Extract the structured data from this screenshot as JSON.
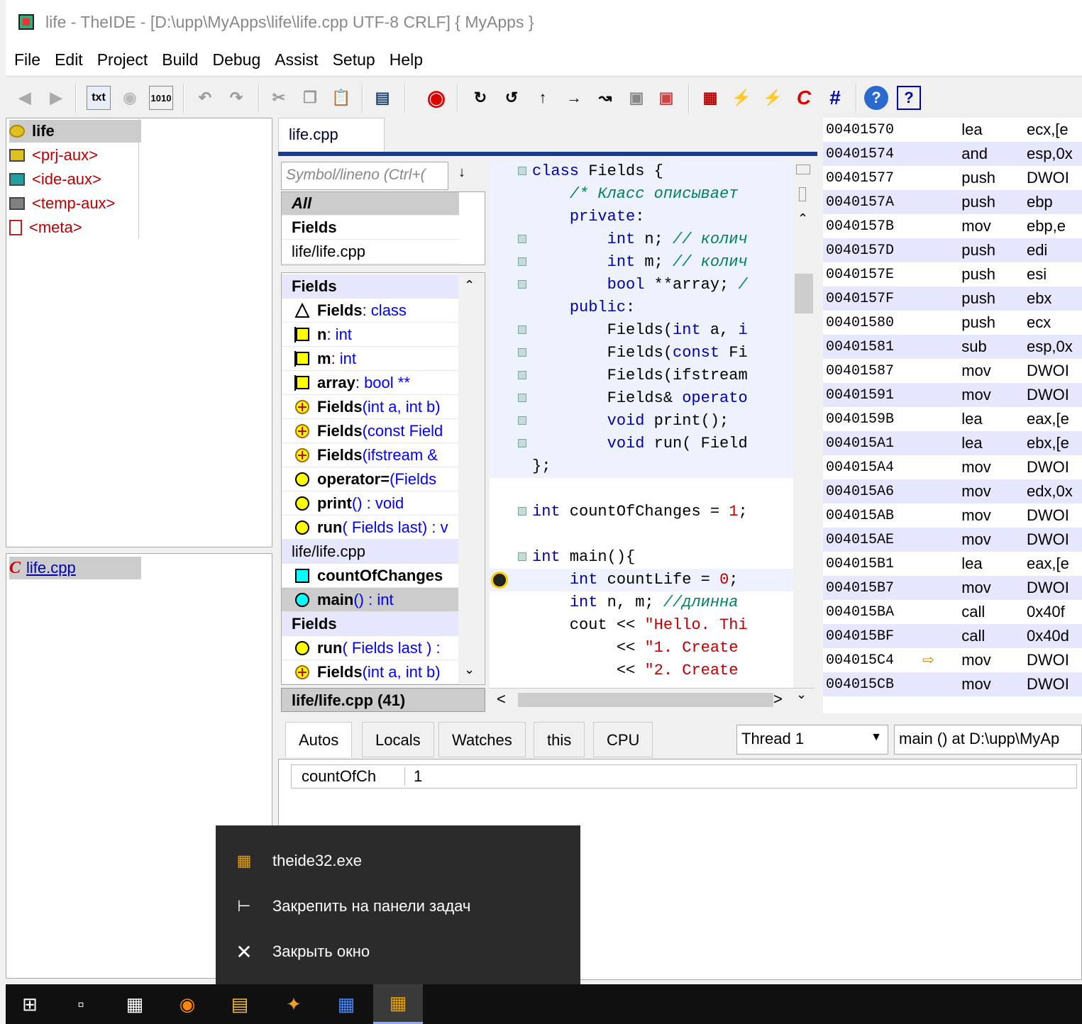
{
  "window": {
    "title": "life - TheIDE - [D:\\upp\\MyApps\\life\\life.cpp UTF-8 CRLF] { MyApps }"
  },
  "menu": [
    "File",
    "Edit",
    "Project",
    "Build",
    "Debug",
    "Assist",
    "Setup",
    "Help"
  ],
  "toolbar": {
    "txt_label": "txt",
    "hex_label": "1010",
    "help_label": "?"
  },
  "packages": {
    "items": [
      {
        "label": "life",
        "color": "#e0c020"
      },
      {
        "label": "<prj-aux>",
        "color": "#e0c020"
      },
      {
        "label": "<ide-aux>",
        "color": "#20a0a0"
      },
      {
        "label": "<temp-aux>",
        "color": "#808080"
      },
      {
        "label": "<meta>",
        "color": "#c02020"
      }
    ]
  },
  "files": {
    "items": [
      {
        "label": "life.cpp"
      }
    ]
  },
  "editor": {
    "tab": "life.cpp"
  },
  "navigator": {
    "search_placeholder": "Symbol/lineno (Ctrl+(",
    "scopes": [
      "All",
      "Fields",
      "life/life.cpp"
    ],
    "members": [
      {
        "type": "header",
        "label": "Fields"
      },
      {
        "icon": "triangle",
        "name": "Fields",
        "sig": " : class"
      },
      {
        "icon": "square",
        "name": "n",
        "sig": " : int"
      },
      {
        "icon": "square",
        "name": "m",
        "sig": " : int"
      },
      {
        "icon": "square",
        "name": "array",
        "sig": " : bool **"
      },
      {
        "icon": "ctor",
        "name": "Fields",
        "sig": "(int a, int b)"
      },
      {
        "icon": "ctor",
        "name": "Fields",
        "sig": "(const Field"
      },
      {
        "icon": "ctor",
        "name": "Fields",
        "sig": "(ifstream &"
      },
      {
        "icon": "circle",
        "name": "operator=",
        "sig": " (Fields"
      },
      {
        "icon": "circle",
        "name": "print",
        "sig": "() : void"
      },
      {
        "icon": "circle",
        "name": "run",
        "sig": "( Fields last) : v"
      },
      {
        "type": "file",
        "label": "life/life.cpp"
      },
      {
        "icon": "sq-cyan",
        "name": "countOfChanges",
        "sig": ""
      },
      {
        "icon": "circ-cyan",
        "name": "main",
        "sig": "() : int"
      },
      {
        "type": "header",
        "label": "Fields"
      },
      {
        "icon": "circle",
        "name": "run",
        "sig": "( Fields last ) :"
      },
      {
        "icon": "ctor",
        "name": "Fields",
        "sig": "(int a, int b)"
      }
    ],
    "bottom_file": "life/life.cpp (41)"
  },
  "code": [
    {
      "g": true,
      "html": "<span class='c-kw'>class</span> Fields {"
    },
    {
      "g": false,
      "html": "    <span class='c-cm'>/* Класс описывает</span>"
    },
    {
      "g": false,
      "html": "    <span class='c-kw'>private</span>:"
    },
    {
      "g": true,
      "html": "        <span class='c-kw'>int</span> n; <span class='c-cm'>// колич</span>"
    },
    {
      "g": true,
      "html": "        <span class='c-kw'>int</span> m; <span class='c-cm'>// колич</span>"
    },
    {
      "g": true,
      "html": "        <span class='c-kw'>bool</span> **array; <span class='c-cm'>/</span>"
    },
    {
      "g": false,
      "html": "    <span class='c-kw'>public</span>:"
    },
    {
      "g": true,
      "html": "        Fields(<span class='c-kw'>int</span> a, <span class='c-kw'>i</span>"
    },
    {
      "g": true,
      "html": "        Fields(<span class='c-kw'>const</span> Fi"
    },
    {
      "g": true,
      "html": "        Fields(ifstream"
    },
    {
      "g": true,
      "html": "        Fields&amp; <span class='c-kw'>operato</span>"
    },
    {
      "g": true,
      "html": "        <span class='c-kw'>void</span> print();"
    },
    {
      "g": true,
      "html": "        <span class='c-kw'>void</span> run( Field"
    },
    {
      "g": false,
      "html": "};"
    },
    {
      "g": false,
      "html": ""
    },
    {
      "g": true,
      "html": "<span class='c-kw'>int</span> countOfChanges = <span class='c-num'>1</span>;"
    },
    {
      "g": false,
      "html": ""
    },
    {
      "g": true,
      "html": "<span class='c-kw'>int</span> main(){"
    },
    {
      "g": false,
      "hl": true,
      "html": "    <span class='c-kw'>int</span> countLife = <span class='c-num'>0</span>;"
    },
    {
      "g": false,
      "html": "    <span class='c-kw'>int</span> n, m; <span class='c-cm'>//длинна</span>"
    },
    {
      "g": false,
      "html": "    cout &lt;&lt; <span class='c-str'>\"Hello. Thi</span>"
    },
    {
      "g": false,
      "html": "         &lt;&lt; <span class='c-str'>\"1. Create</span>"
    },
    {
      "g": false,
      "html": "         &lt;&lt; <span class='c-str'>\"2. Create</span>"
    }
  ],
  "disasm": [
    {
      "addr": "00401570",
      "op": "lea",
      "arg": "ecx,[e"
    },
    {
      "addr": "00401574",
      "op": "and",
      "arg": "esp,0x"
    },
    {
      "addr": "00401577",
      "op": "push",
      "arg": "DWOI"
    },
    {
      "addr": "0040157A",
      "op": "push",
      "arg": "ebp"
    },
    {
      "addr": "0040157B",
      "op": "mov",
      "arg": "ebp,e"
    },
    {
      "addr": "0040157D",
      "op": "push",
      "arg": "edi"
    },
    {
      "addr": "0040157E",
      "op": "push",
      "arg": "esi"
    },
    {
      "addr": "0040157F",
      "op": "push",
      "arg": "ebx"
    },
    {
      "addr": "00401580",
      "op": "push",
      "arg": "ecx"
    },
    {
      "addr": "00401581",
      "op": "sub",
      "arg": "esp,0x"
    },
    {
      "addr": "00401587",
      "op": "mov",
      "arg": "DWOI"
    },
    {
      "addr": "00401591",
      "op": "mov",
      "arg": "DWOI"
    },
    {
      "addr": "0040159B",
      "op": "lea",
      "arg": "eax,[e"
    },
    {
      "addr": "004015A1",
      "op": "lea",
      "arg": "ebx,[e"
    },
    {
      "addr": "004015A4",
      "op": "mov",
      "arg": "DWOI"
    },
    {
      "addr": "004015A6",
      "op": "mov",
      "arg": "edx,0x"
    },
    {
      "addr": "004015AB",
      "op": "mov",
      "arg": "DWOI"
    },
    {
      "addr": "004015AE",
      "op": "mov",
      "arg": "DWOI"
    },
    {
      "addr": "004015B1",
      "op": "lea",
      "arg": "eax,[e"
    },
    {
      "addr": "004015B7",
      "op": "mov",
      "arg": "DWOI"
    },
    {
      "addr": "004015BA",
      "op": "call",
      "arg": "0x40f"
    },
    {
      "addr": "004015BF",
      "op": "call",
      "arg": "0x40d"
    },
    {
      "addr": "004015C4",
      "op": "mov",
      "arg": "DWOI",
      "current": true
    },
    {
      "addr": "004015CB",
      "op": "mov",
      "arg": "DWOI"
    }
  ],
  "debug": {
    "tabs": [
      "Autos",
      "Locals",
      "Watches",
      "this",
      "CPU"
    ],
    "thread": "Thread 1",
    "frame": "main () at D:\\upp\\MyAp",
    "vars": [
      {
        "name": "countOfCh",
        "value": "1"
      }
    ]
  },
  "context_menu": {
    "items": [
      {
        "icon": "app-icon",
        "label": "theide32.exe"
      },
      {
        "icon": "pin-icon",
        "label": "Закрепить на панели задач"
      },
      {
        "icon": "close-icon",
        "label": "Закрыть окно"
      }
    ]
  }
}
